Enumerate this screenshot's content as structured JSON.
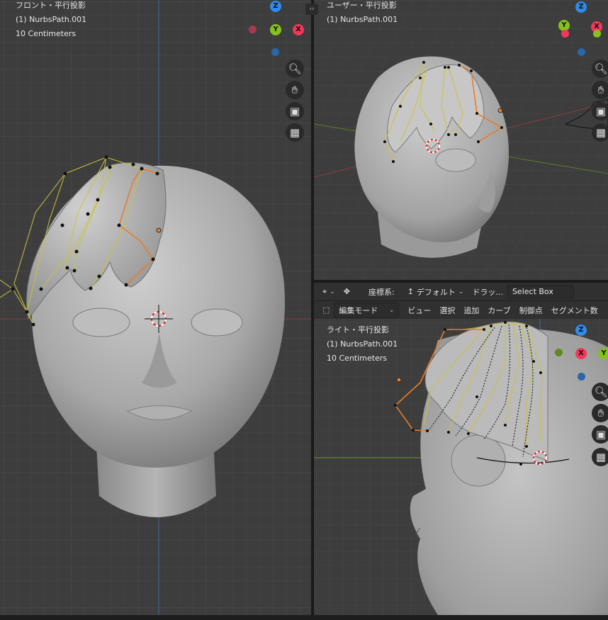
{
  "viewports": {
    "front": {
      "view_name": "フロント・平行投影",
      "object": "(1) NurbsPath.001",
      "scale": "10 Centimeters"
    },
    "user": {
      "view_name": "ユーザー・平行投影",
      "object": "(1) NurbsPath.001"
    },
    "right": {
      "view_name": "ライト・平行投影",
      "object": "(1) NurbsPath.001",
      "scale": "10 Centimeters"
    }
  },
  "gizmo_labels": {
    "z": "Z",
    "y": "Y",
    "x": "X"
  },
  "icons": [
    "zoom-icon",
    "hand-pan-icon",
    "camera-icon",
    "grid-ortho-icon",
    "pivot-icon",
    "transform-icon"
  ],
  "toolbar": {
    "orientation_label": "座標系:",
    "orientation_value": "デフォルト",
    "drag_label": "ドラッ...",
    "select_box": "Select Box"
  },
  "header_menu": {
    "mode": "編集モード",
    "items": [
      "ビュー",
      "選択",
      "追加",
      "カーブ",
      "制御点",
      "セグメント数"
    ]
  },
  "colors": {
    "x_axis": "#f5365c",
    "y_axis": "#84c11f",
    "z_axis": "#2d8ceb",
    "curve_active": "#e87d2a",
    "curve": "#c9c33a"
  }
}
